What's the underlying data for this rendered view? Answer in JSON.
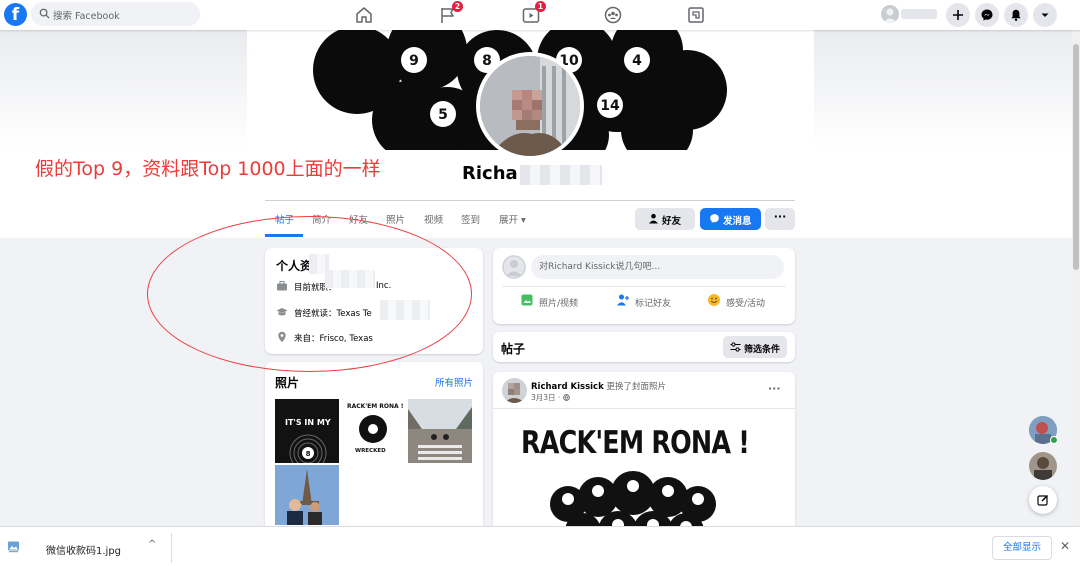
{
  "nav": {
    "logo_letter": "f",
    "search_placeholder": "搜索 Facebook",
    "badges": {
      "pages": "2",
      "watch": "1"
    }
  },
  "profile": {
    "name": "Richa",
    "annotation": "假的Top 9，资料跟Top 1000上面的一样"
  },
  "tabs": [
    {
      "label": "帖子",
      "active": true
    },
    {
      "label": "简介"
    },
    {
      "label": "好友"
    },
    {
      "label": "照片"
    },
    {
      "label": "视频"
    },
    {
      "label": "签到"
    },
    {
      "label": "展开 ▾"
    }
  ],
  "actions": {
    "friend": "好友",
    "message": "发消息",
    "more": "···"
  },
  "intro": {
    "title": "个人资",
    "work": "目前就职：",
    "work_suffix": "Inc.",
    "study": "曾经就读：Texas Te",
    "study_suffix": "y",
    "from": "来自：Frisco, Texas"
  },
  "photos": {
    "title": "照片",
    "all_link": "所有照片",
    "thumb1_text": "IT'S IN MY",
    "thumb2_title": "RACK'EM RONA !",
    "thumb2_sub": "WRECKED"
  },
  "composer": {
    "placeholder": "对Richard Kissick说几句吧...",
    "photo_video": "照片/视频",
    "tag_friends": "标记好友",
    "feeling": "感受/活动"
  },
  "posts": {
    "title": "帖子",
    "filter": "筛选条件",
    "author": "Richard Kissick",
    "action": "更换了封面照片",
    "date": "3月3日 · ",
    "more": "···",
    "image_title": "RACK'EM RONA !"
  },
  "cover": {
    "balls": [
      "9",
      "10",
      "5",
      "14",
      "4",
      "8"
    ]
  },
  "download": {
    "file": "微信收款码1.jpg",
    "show_all": "全部显示",
    "close": "✕",
    "chevron": "^"
  },
  "colors": {
    "brand": "#1877f2",
    "annotation_red": "#ef3a37",
    "badge": "#e41e3f"
  }
}
